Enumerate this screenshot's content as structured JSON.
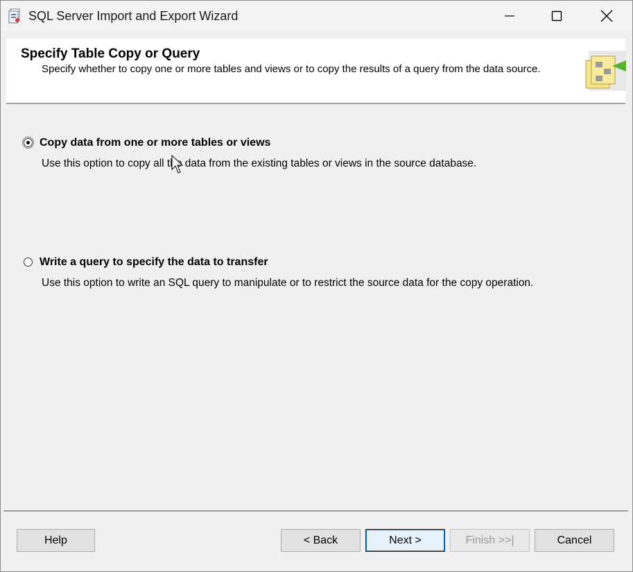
{
  "window": {
    "title": "SQL Server Import and Export Wizard"
  },
  "header": {
    "title": "Specify Table Copy or Query",
    "description": "Specify whether to copy one or more tables and views or to copy the results of a query from the data source."
  },
  "options": [
    {
      "label": "Copy data from one or more tables or views",
      "description": "Use this option to copy all the data from the existing tables or views in the source database.",
      "selected": true
    },
    {
      "label": "Write a query to specify the data to transfer",
      "description": "Use this option to write an SQL query to manipulate or to restrict the source data for the copy operation.",
      "selected": false
    }
  ],
  "buttons": {
    "help": "Help",
    "back": "< Back",
    "next": "Next >",
    "finish": "Finish >>|",
    "cancel": "Cancel"
  },
  "colors": {
    "background": "#f0f0f0",
    "header_bg": "#ffffff",
    "disabled_text": "#9a9a9a"
  },
  "icons": [
    "app-icon",
    "minimize-icon",
    "maximize-icon",
    "close-icon",
    "wizard-graphic",
    "mouse-cursor"
  ]
}
